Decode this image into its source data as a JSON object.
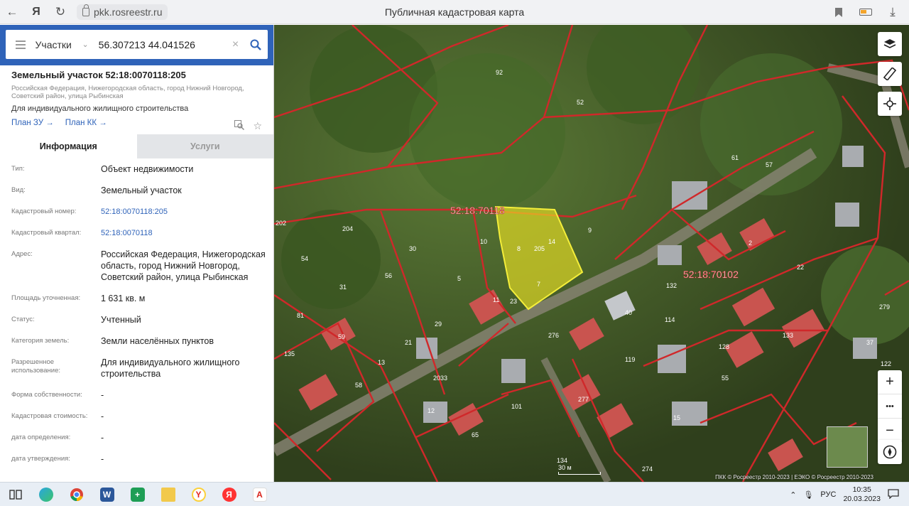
{
  "browser": {
    "url": "pkk.rosreestr.ru",
    "page_title": "Публичная кадастровая карта",
    "icons": [
      "back-arrow-icon",
      "yandex-logo-icon",
      "reload-icon",
      "lock-icon",
      "bookmark-icon",
      "battery-icon",
      "download-icon"
    ]
  },
  "search": {
    "layer": "Участки",
    "query": "56.307213 44.041526"
  },
  "object": {
    "title": "Земельный участок 52:18:0070118:205",
    "address": "Российская Федерация, Нижегородская область, город Нижний Новгород, Советский район, улица Рыбинская",
    "purpose": "Для индивидуального жилищного строительства",
    "plan_zu": "План ЗУ",
    "plan_kk": "План КК"
  },
  "tabs": [
    {
      "label": "Информация",
      "active": true
    },
    {
      "label": "Услуги",
      "active": false
    }
  ],
  "info": [
    {
      "label": "Тип:",
      "value": "Объект недвижимости"
    },
    {
      "label": "Вид:",
      "value": "Земельный участок"
    },
    {
      "label": "Кадастровый номер:",
      "value": "52:18:0070118:205"
    },
    {
      "label": "Кадастровый квартал:",
      "value": "52:18:0070118"
    },
    {
      "label": "Адрес:",
      "value": "Российская Федерация, Нижегородская область, город Нижний Новгород, Советский район, улица Рыбинская"
    },
    {
      "label": "Площадь уточненная:",
      "value": "1 631 кв. м"
    },
    {
      "label": "Статус:",
      "value": "Учтенный"
    },
    {
      "label": "Категория земель:",
      "value": "Земли населённых пунктов"
    },
    {
      "label": "Разрешенное использование:",
      "value": "Для индивидуального жилищного строительства"
    },
    {
      "label": "Форма собственности:",
      "value": "-"
    },
    {
      "label": "Кадастровая стоимость:",
      "value": "-"
    },
    {
      "label": "дата определения:",
      "value": "-"
    },
    {
      "label": "дата утверждения:",
      "value": "-"
    }
  ],
  "map": {
    "quarter_label_1": "52:18:70118",
    "quarter_label_2": "52:18:70102",
    "parcel_labels": [
      "205",
      "8",
      "14",
      "7",
      "9",
      "10",
      "5",
      "11",
      "23",
      "2",
      "30",
      "204",
      "54",
      "31",
      "56",
      "29",
      "21",
      "59",
      "13",
      "58",
      "135",
      "81",
      "202",
      "57",
      "61",
      "22",
      "37",
      "122",
      "40",
      "114",
      "15",
      "276",
      "277",
      "101",
      "65",
      "12",
      "134",
      "274",
      "52",
      "92",
      "119",
      "55",
      "132",
      "128",
      "133",
      "279",
      "2033"
    ],
    "attribution": "ПКК © Росреестр 2010-2023 | ЕЭКО © Росреестр 2010-2023",
    "scale": "30 м",
    "controls": [
      "layers-icon",
      "ruler-icon",
      "locate-icon"
    ],
    "zoom_in": "+",
    "zoom_more": "•••",
    "zoom_out": "−"
  },
  "taskbar": {
    "apps": [
      "task-view-icon",
      "edge-icon",
      "chrome-icon",
      "word-icon",
      "sheets-icon",
      "file-explorer-icon",
      "yandex-browser-icon",
      "yandex-icon",
      "pdf-icon"
    ],
    "lang": "РУС",
    "time": "10:35",
    "date": "20.03.2023"
  }
}
